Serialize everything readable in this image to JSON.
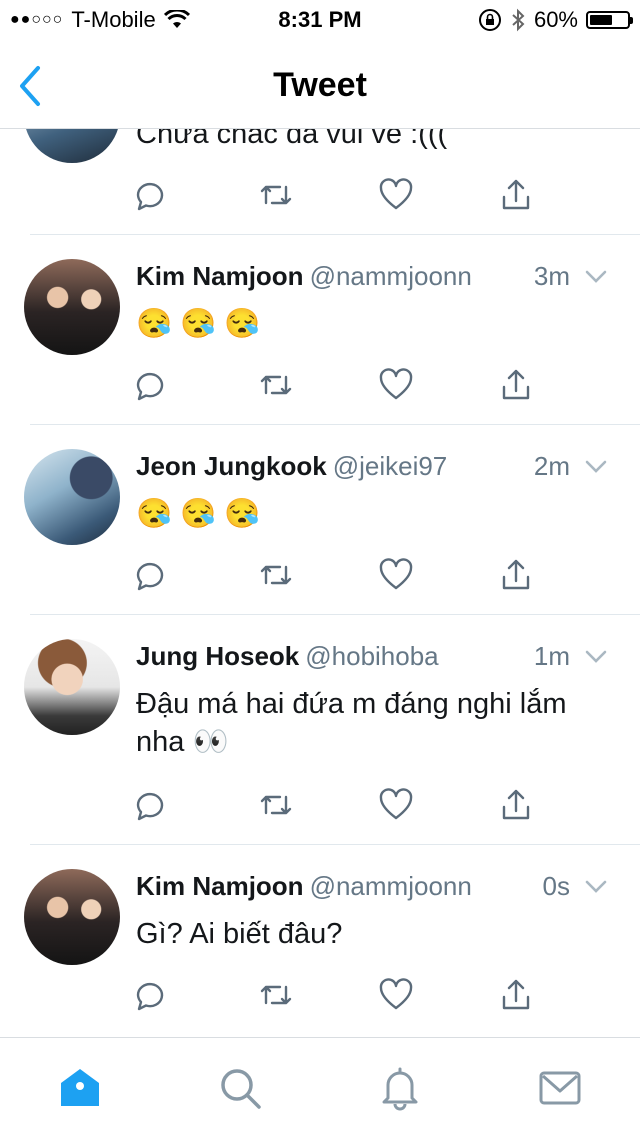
{
  "status": {
    "carrier": "T-Mobile",
    "signal_dots": "●●○○○",
    "time": "8:31 PM",
    "battery": "60%",
    "battery_level": 0.6
  },
  "nav": {
    "title": "Tweet"
  },
  "partial_tweet": {
    "text": "Chưa chắc đã vui vẻ :((("
  },
  "tweets": [
    {
      "name": "Kim Namjoon",
      "handle": "@nammjoonn",
      "time": "3m",
      "text": "😪 😪 😪"
    },
    {
      "name": "Jeon Jungkook",
      "handle": "@jeikei97",
      "time": "2m",
      "text": "😪 😪 😪"
    },
    {
      "name": "Jung Hoseok",
      "handle": "@hobihoba",
      "time": "1m",
      "text": "Đậu má hai đứa m đáng nghi lắm nha 👀"
    },
    {
      "name": "Kim Namjoon",
      "handle": "@nammjoonn",
      "time": "0s",
      "text": "Gì? Ai biết đâu?"
    }
  ],
  "icons": {
    "back": "chevron-left-icon",
    "reply": "reply-icon",
    "retweet": "retweet-icon",
    "like": "heart-icon",
    "share": "share-icon",
    "home": "home-icon",
    "search": "search-icon",
    "notifications": "bell-icon",
    "messages": "mail-icon"
  },
  "colors": {
    "accent": "#1da1f2",
    "muted": "#657786",
    "icon": "#5b6b7a"
  }
}
